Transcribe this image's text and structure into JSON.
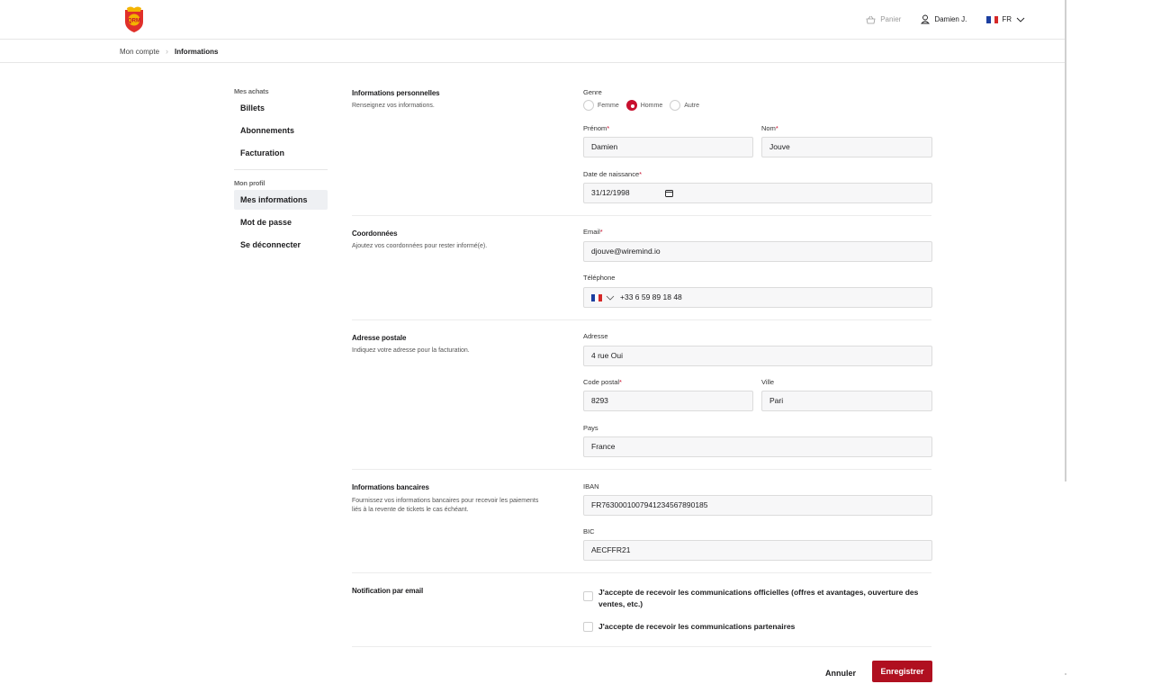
{
  "header": {
    "cart_label": "Panier",
    "user_label": "Damien J.",
    "language": "FR"
  },
  "breadcrumb": {
    "root": "Mon compte",
    "current": "Informations"
  },
  "sidebar": {
    "purchases_title": "Mes achats",
    "purchases": [
      "Billets",
      "Abonnements",
      "Facturation"
    ],
    "profile_title": "Mon profil",
    "profile": [
      "Mes informations",
      "Mot de passe",
      "Se déconnecter"
    ]
  },
  "personal": {
    "title": "Informations personnelles",
    "description": "Renseignez vos informations.",
    "gender_label": "Genre",
    "gender_options": [
      "Femme",
      "Homme",
      "Autre"
    ],
    "gender_selected": "Homme",
    "firstname_label": "Prénom",
    "firstname_value": "Damien",
    "lastname_label": "Nom",
    "lastname_value": "Jouve",
    "birthdate_label": "Date de naissance",
    "birthdate_value": "31/12/1998"
  },
  "contact": {
    "title": "Coordonnées",
    "description": "Ajoutez vos coordonnées pour rester informé(e).",
    "email_label": "Email",
    "email_value": "djouve@wiremind.io",
    "phone_label": "Téléphone",
    "phone_value": "+33 6 59 89 18 48"
  },
  "address": {
    "title": "Adresse postale",
    "description": "Indiquez votre adresse pour la facturation.",
    "street_label": "Adresse",
    "street_value": "4 rue Oui",
    "zip_label": "Code postal",
    "zip_value": "8293",
    "city_label": "Ville",
    "city_value": "Pari",
    "country_label": "Pays",
    "country_value": "France"
  },
  "bank": {
    "title": "Informations bancaires",
    "description": "Fournissez vos informations bancaires pour recevoir les paiements liés à la revente de tickets le cas échéant.",
    "iban_label": "IBAN",
    "iban_value": "FR7630001007941234567890185",
    "bic_label": "BIC",
    "bic_value": "AECFFR21"
  },
  "notifications": {
    "title": "Notification par email",
    "official": "J'accepte de recevoir les communications officielles (offres et avantages, ouverture des ventes, etc.)",
    "partners": "J'accepte de recevoir les communications partenaires"
  },
  "actions": {
    "cancel": "Annuler",
    "save": "Enregistrer"
  },
  "colors": {
    "brand_red": "#b01020",
    "accent_red": "#c8102e",
    "flag_blue": "#1c3fa0",
    "flag_red": "#d62828"
  }
}
